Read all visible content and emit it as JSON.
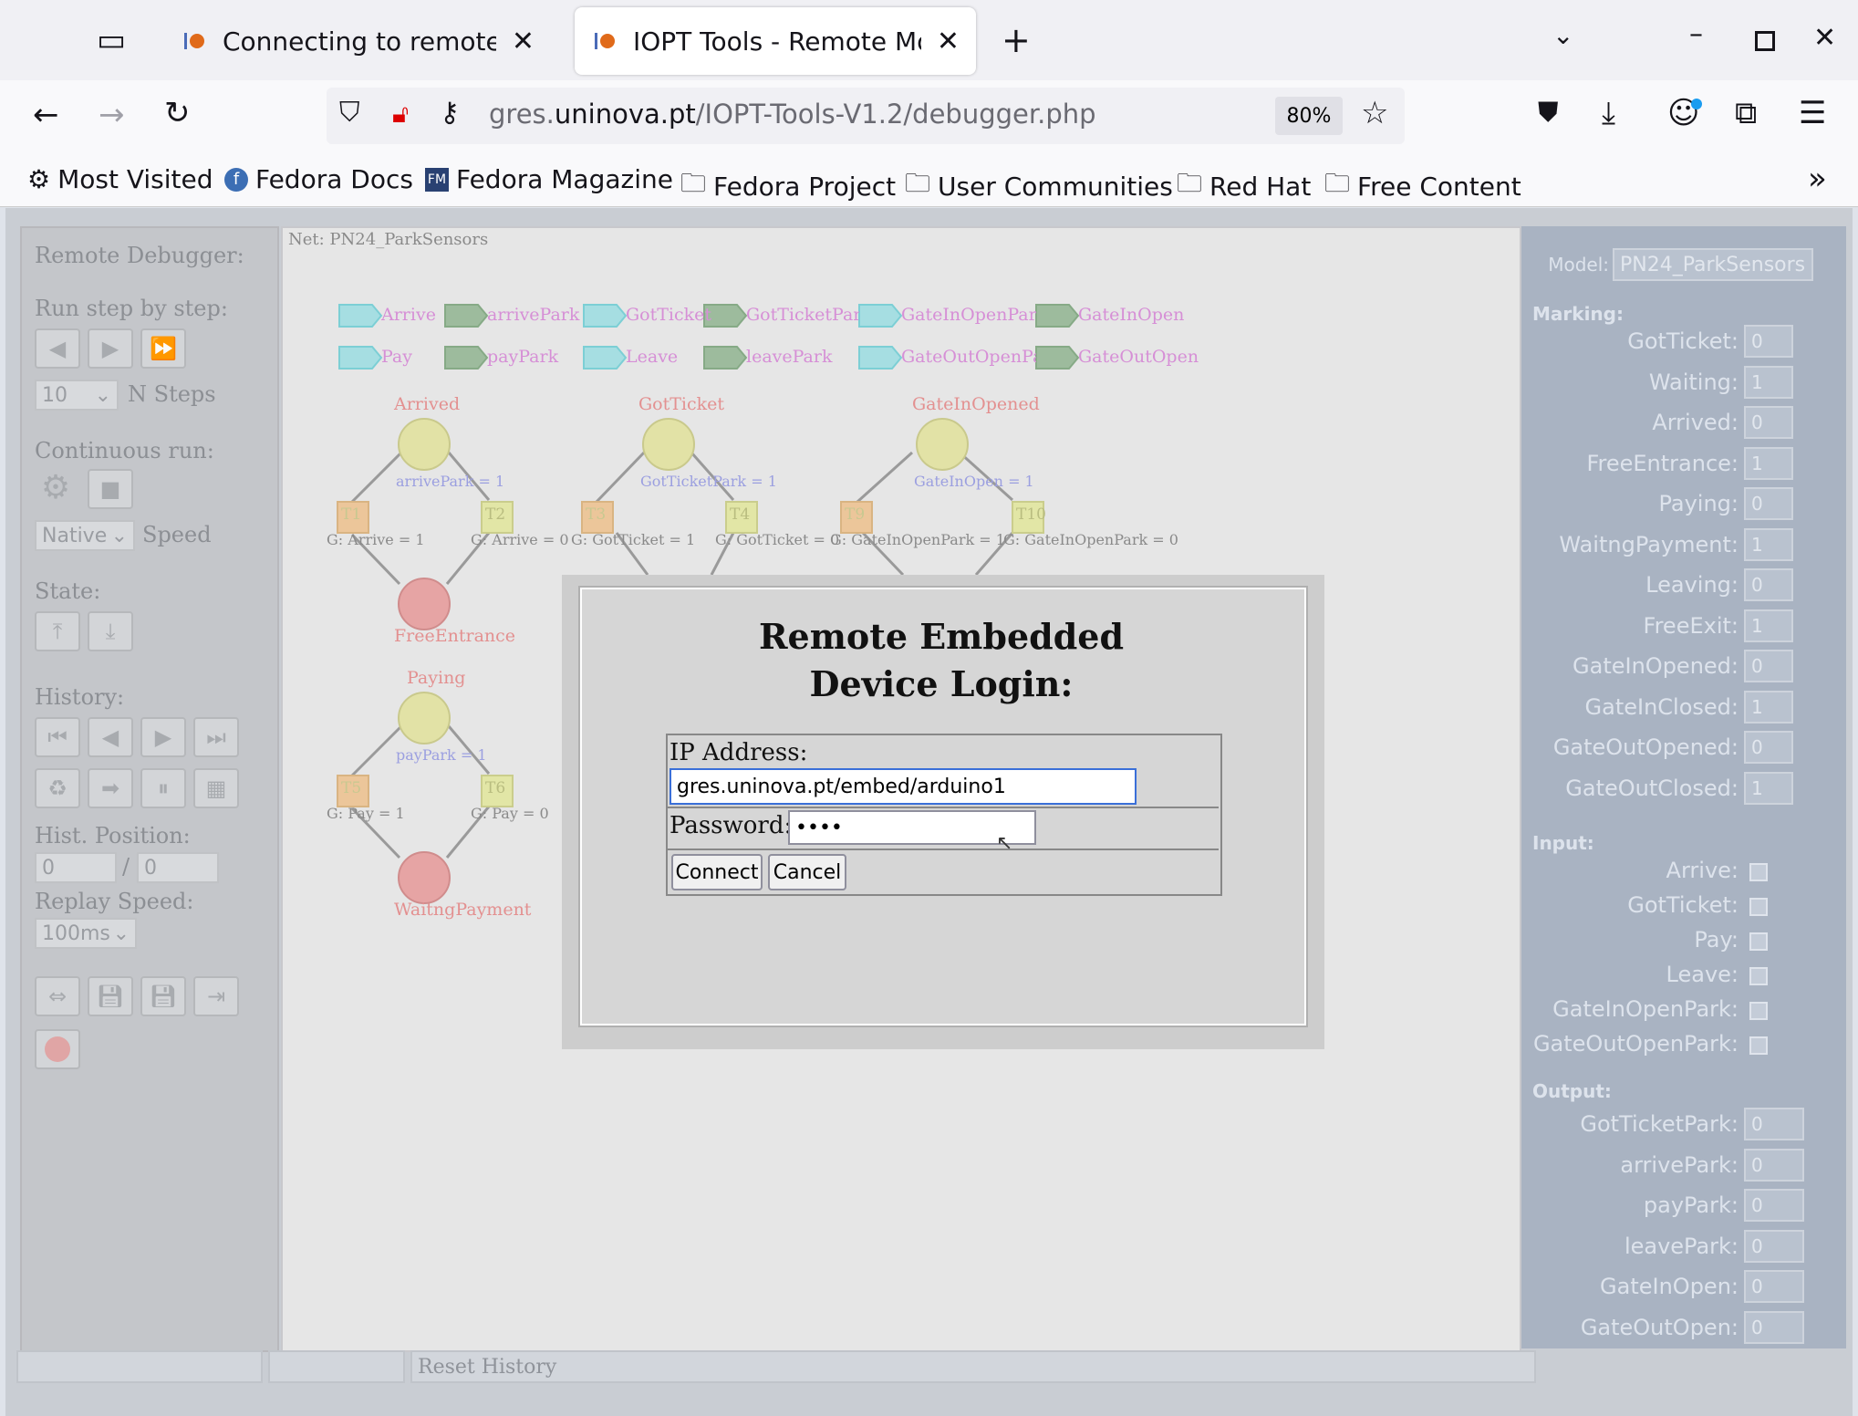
{
  "browser": {
    "tabs": [
      {
        "title": "Connecting to remote hardware",
        "active": false
      },
      {
        "title": "IOPT Tools - Remote Monitor",
        "active": true
      }
    ],
    "url_domain": "gres.",
    "url_host": "uninova.pt",
    "url_path": "/IOPT-Tools-V1.2/debugger.php",
    "zoom": "80%",
    "bookmarks": [
      "Most Visited",
      "Fedora Docs",
      "Fedora Magazine",
      "Fedora Project",
      "User Communities",
      "Red Hat",
      "Free Content"
    ]
  },
  "left_panel": {
    "title": "Remote Debugger:",
    "run_step": "Run step by step:",
    "nsteps_value": "10",
    "nsteps_label": "N Steps",
    "continuous": "Continuous run:",
    "speed_value": "Native",
    "speed_label": "Speed",
    "state": "State:",
    "history": "History:",
    "hist_position": "Hist. Position:",
    "hist_pos_a": "0",
    "hist_pos_sep": "/",
    "hist_pos_b": "0",
    "replay_speed": "Replay Speed:",
    "replay_value": "100ms"
  },
  "canvas": {
    "net_label": "Net: PN24_ParkSensors",
    "events_row1": [
      "Arrive",
      "arrivePark",
      "GotTicket",
      "GotTicketPark",
      "GateInOpenPark",
      "GateInOpen"
    ],
    "events_row2": [
      "Pay",
      "payPark",
      "Leave",
      "leavePark",
      "GateOutOpenPark",
      "GateOutOpen"
    ],
    "places": {
      "arrived": "Arrived",
      "gotticket": "GotTicket",
      "gateinopened": "GateInOpened",
      "freeentrance": "FreeEntrance",
      "paying": "Paying",
      "waitngpayment": "WaitngPayment"
    },
    "transitions": [
      "T1",
      "T2",
      "T3",
      "T4",
      "T9",
      "T10",
      "T5",
      "T6"
    ],
    "arcs": {
      "a1": "arrivePark = 1",
      "a2": "GotTicketPark = 1",
      "a3": "GateInOpen = 1",
      "a4": "payPark = 1"
    },
    "guards": {
      "g1": "G: Arrive = 1",
      "g2": "G: Arrive = 0",
      "g3": "G: GotTicket = 1",
      "g4": "G: GotTicket = 0",
      "g5": "G: GateInOpenPark = 1",
      "g6": "G: GateInOpenPark = 0",
      "g7": "G: Pay = 1",
      "g8": "G: Pay = 0"
    }
  },
  "modal": {
    "title_line1": "Remote Embedded",
    "title_line2": "Device Login:",
    "ip_label": "IP Address:",
    "ip_value": "gres.uninova.pt/embed/arduino1",
    "password_label": "Password:",
    "password_value": "••••",
    "connect": "Connect",
    "cancel": "Cancel"
  },
  "right_panel": {
    "model_label": "Model:",
    "model_value": "PN24_ParkSensors",
    "marking_head": "Marking:",
    "marking": [
      {
        "name": "GotTicket:",
        "value": "0"
      },
      {
        "name": "Waiting:",
        "value": "1"
      },
      {
        "name": "Arrived:",
        "value": "0"
      },
      {
        "name": "FreeEntrance:",
        "value": "1"
      },
      {
        "name": "Paying:",
        "value": "0"
      },
      {
        "name": "WaitngPayment:",
        "value": "1"
      },
      {
        "name": "Leaving:",
        "value": "0"
      },
      {
        "name": "FreeExit:",
        "value": "1"
      },
      {
        "name": "GateInOpened:",
        "value": "0"
      },
      {
        "name": "GateInClosed:",
        "value": "1"
      },
      {
        "name": "GateOutOpened:",
        "value": "0"
      },
      {
        "name": "GateOutClosed:",
        "value": "1"
      }
    ],
    "input_head": "Input:",
    "inputs": [
      "Arrive:",
      "GotTicket:",
      "Pay:",
      "Leave:",
      "GateInOpenPark:",
      "GateOutOpenPark:"
    ],
    "output_head": "Output:",
    "outputs": [
      {
        "name": "GotTicketPark:",
        "value": "0"
      },
      {
        "name": "arrivePark:",
        "value": "0"
      },
      {
        "name": "payPark:",
        "value": "0"
      },
      {
        "name": "leavePark:",
        "value": "0"
      },
      {
        "name": "GateInOpen:",
        "value": "0"
      },
      {
        "name": "GateOutOpen:",
        "value": "0"
      }
    ]
  },
  "statusbar": {
    "reset": "Reset History"
  }
}
